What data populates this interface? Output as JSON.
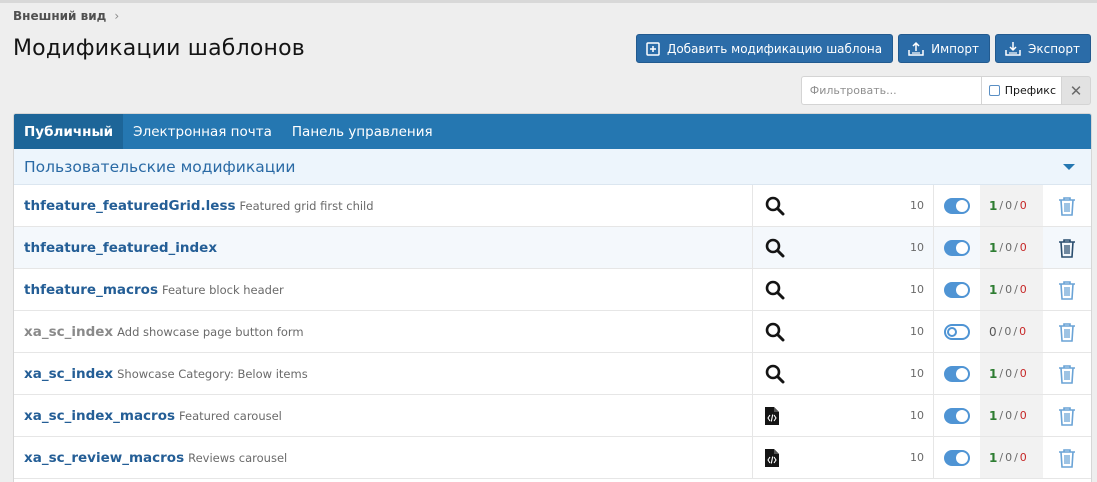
{
  "breadcrumb": {
    "label": "Внешний вид",
    "chevron": "›"
  },
  "page_title": "Модификации шаблонов",
  "actions": {
    "add_label": "Добавить модификацию шаблона",
    "import_label": "Импорт",
    "export_label": "Экспорт"
  },
  "filter": {
    "placeholder": "Фильтровать...",
    "prefix_label": "Префикс",
    "clear_glyph": "✕"
  },
  "tabs": [
    {
      "label": "Публичный",
      "active": true
    },
    {
      "label": "Электронная почта",
      "active": false
    },
    {
      "label": "Панель управления",
      "active": false
    }
  ],
  "section": {
    "title": "Пользовательские модификации"
  },
  "stat_sep": "/",
  "colors": {
    "brand": "#2577b1",
    "button": "#2b6ca8",
    "link": "#245e96",
    "ok": "#2e7d32",
    "error": "#c62828"
  },
  "rows": [
    {
      "name": "thfeature_featuredGrid.less",
      "desc": "Featured grid first child",
      "icon": "search-icon",
      "order": "10",
      "enabled": true,
      "ok": "1",
      "warn": "0",
      "err": "0"
    },
    {
      "name": "thfeature_featured_index",
      "desc": "",
      "icon": "search-icon",
      "order": "10",
      "enabled": true,
      "ok": "1",
      "warn": "0",
      "err": "0"
    },
    {
      "name": "thfeature_macros",
      "desc": "Feature block header",
      "icon": "search-icon",
      "order": "10",
      "enabled": true,
      "ok": "1",
      "warn": "0",
      "err": "0"
    },
    {
      "name": "xa_sc_index",
      "desc": "Add showcase page button form",
      "icon": "search-icon",
      "order": "10",
      "enabled": false,
      "ok": "0",
      "warn": "0",
      "err": "0"
    },
    {
      "name": "xa_sc_index",
      "desc": "Showcase Category: Below items",
      "icon": "search-icon",
      "order": "10",
      "enabled": true,
      "ok": "1",
      "warn": "0",
      "err": "0"
    },
    {
      "name": "xa_sc_index_macros",
      "desc": "Featured carousel",
      "icon": "code-file-icon",
      "order": "10",
      "enabled": true,
      "ok": "1",
      "warn": "0",
      "err": "0"
    },
    {
      "name": "xa_sc_review_macros",
      "desc": "Reviews carousel",
      "icon": "code-file-icon",
      "order": "10",
      "enabled": true,
      "ok": "1",
      "warn": "0",
      "err": "0"
    }
  ]
}
